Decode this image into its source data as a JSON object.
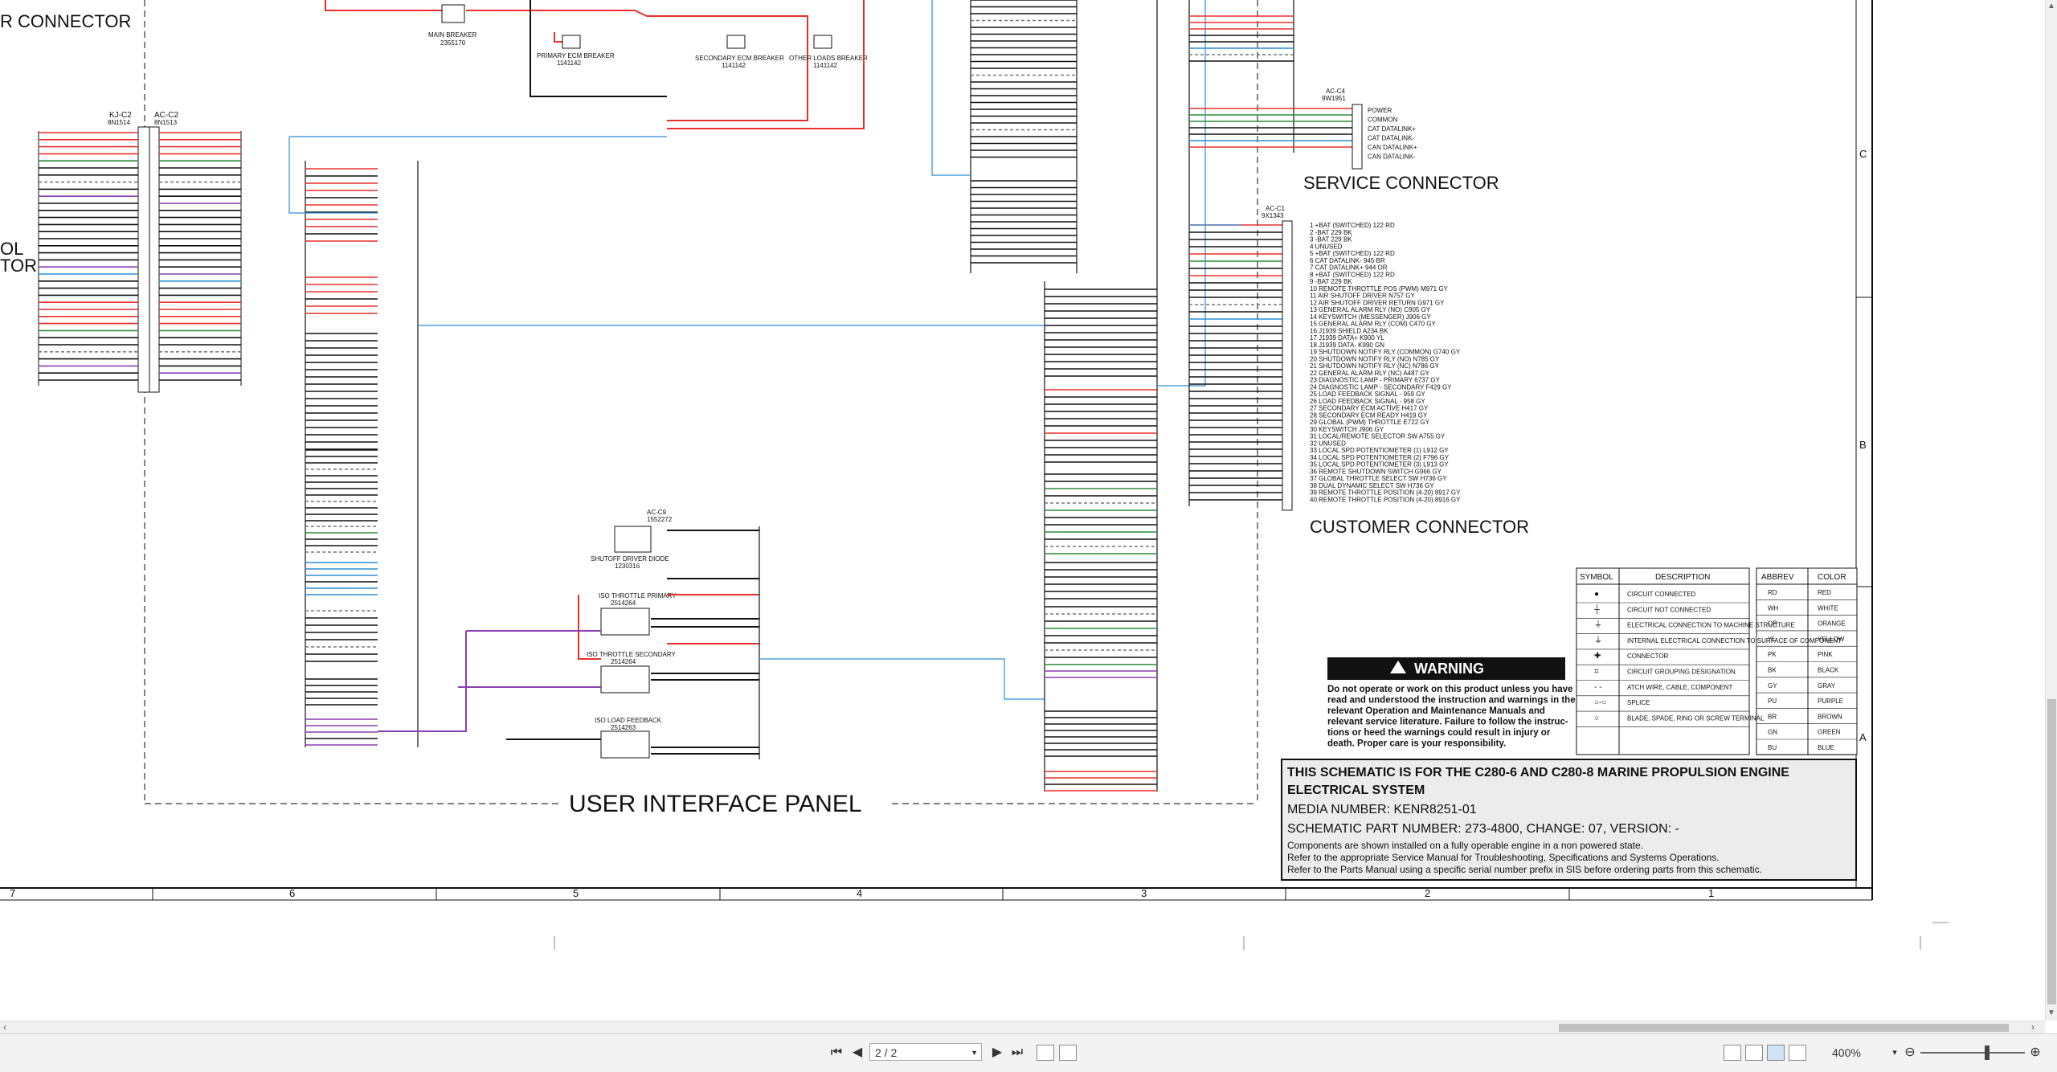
{
  "document": {
    "title_lines": [
      "THIS SCHEMATIC IS FOR THE C280-6 AND C280-8 MARINE PROPULSION ENGINE",
      "ELECTRICAL SYSTEM"
    ],
    "media": "MEDIA NUMBER: KENR8251-01",
    "part": "SCHEMATIC PART NUMBER: 273-4800, CHANGE: 07, VERSION: -",
    "notes": [
      "Components are shown installed on a fully operable engine in a non powered state.",
      "Refer to the appropriate Service Manual for Troubleshooting, Specifications and Systems Operations.",
      "Refer to the Parts Manual using a specific serial number prefix in SIS before ordering parts from this schematic."
    ],
    "section_labels": {
      "user_interface": "USER INTERFACE PANEL",
      "service_connector": "SERVICE CONNECTOR",
      "customer_connector": "CUSTOMER CONNECTOR",
      "connector_top_left": "R CONNECTOR",
      "left_fragment_1": "OL",
      "left_fragment_2": "TOR"
    },
    "warning": {
      "title": "WARNING",
      "lines": [
        "Do not operate or work on this product unless you have",
        "read and understood the instruction and warnings in the",
        "relevant Operation and Maintenance Manuals and",
        "relevant service literature. Failure to follow the instruc-",
        "tions or heed the warnings could result in injury or",
        "death. Proper care is your responsibility."
      ]
    },
    "grid_columns": [
      "7",
      "6",
      "5",
      "4",
      "3",
      "2",
      "1"
    ],
    "grid_rows": [
      "C",
      "B",
      "A"
    ],
    "components": {
      "main_breaker": [
        "MAIN BREAKER",
        "2355170"
      ],
      "primary_ecm": [
        "PRIMARY ECM BREAKER",
        "1141142"
      ],
      "secondary_ecm": [
        "SECONDARY ECM BREAKER",
        "1141142"
      ],
      "other_loads": [
        "OTHER LOADS BREAKER",
        "1141142"
      ],
      "shutoff_diode": [
        "SHUTOFF DRIVER DIODE",
        "1230316"
      ],
      "iso_primary": [
        "ISO THROTTLE PRIMARY",
        "2514264"
      ],
      "iso_secondary": [
        "ISO THROTTLE SECONDARY",
        "2514264"
      ],
      "iso_load": [
        "ISO LOAD FEEDBACK",
        "2514263"
      ],
      "ac_c9": [
        "AC-C9",
        "1552272"
      ],
      "kj_c2": [
        "KJ-C2",
        "8N1514"
      ],
      "ac_c2": [
        "AC-C2",
        "8N1513"
      ],
      "ac_c4": [
        "AC-C4",
        "9W1951"
      ],
      "ac_c1": [
        "AC-C1",
        "9X1343"
      ]
    },
    "service_pins": [
      "POWER",
      "COMMON",
      "CAT DATALINK+",
      "CAT DATALINK-",
      "CAN DATALINK+",
      "CAN DATALINK-"
    ],
    "customer_pins": [
      "1 +BAT (SWITCHED) 122 RD",
      "2 -BAT 229 BK",
      "3 -BAT 229 BK",
      "4 UNUSED",
      "5 +BAT (SWITCHED) 122 RD",
      "6 CAT DATALINK- 945 BR",
      "7 CAT DATALINK+ 944 OR",
      "8 +BAT (SWITCHED) 122 RD",
      "9 -BAT 229 BK",
      "10 REMOTE THROTTLE POS (PWM) M971 GY",
      "11 AIR SHUTOFF DRIVER N757 GY",
      "12 AIR SHUTOFF DRIVER RETURN G971 GY",
      "13 GENERAL ALARM RLY (NO) C905 GY",
      "14 KEYSWITCH (MESSENGER) J906 GY",
      "15 GENERAL ALARM RLY (COM) C470 GY",
      "16 J1939 SHIELD A234 BK",
      "17 J1939 DATA+ K900 YL",
      "18 J1939 DATA- K990 GN",
      "19 SHUTDOWN NOTIFY RLY (COMMON) G740 GY",
      "20 SHUTDOWN NOTIFY RLY (NO) N785 GY",
      "21 SHUTDOWN NOTIFY RLY (NC) N786 GY",
      "22 GENERAL ALARM RLY (NC) A487 GY",
      "23 DIAGNOSTIC LAMP - PRIMARY 6737 GY",
      "24 DIAGNOSTIC LAMP - SECONDARY F429 GY",
      "25 LOAD FEEDBACK SIGNAL - 959 GY",
      "26 LOAD FEEDBACK SIGNAL - 958 GY",
      "27 SECONDARY ECM ACTIVE H417 GY",
      "28 SECONDARY ECM READY H419 GY",
      "29 GLOBAL (PWM) THROTTLE E722 GY",
      "30 KEYSWITCH J906 GY",
      "31 LOCAL/REMOTE SELECTOR SW A755 GY",
      "32 UNUSED",
      "33 LOCAL SPD POTENTIOMETER (1) L912 GY",
      "34 LOCAL SPD POTENTIOMETER (2) F796 GY",
      "35 LOCAL SPD POTENTIOMETER (3) L913 GY",
      "36 REMOTE SHUTDOWN SWITCH G966 GY",
      "37 GLOBAL THROTTLE SELECT SW H736 GY",
      "38 DUAL DYNAMIC SELECT SW H736 GY",
      "39 REMOTE THROTTLE POSITION (4-20) 8917 GY",
      "40 REMOTE THROTTLE POSITION (4-20) 8916 GY"
    ],
    "legend": {
      "headers": [
        "SYMBOL",
        "DESCRIPTION",
        "ABBREV",
        "COLOR"
      ],
      "rows": [
        [
          "CIRCUIT CONNECTED",
          "RD",
          "RED"
        ],
        [
          "CIRCUIT NOT CONNECTED",
          "WH",
          "WHITE"
        ],
        [
          "ELECTRICAL CONNECTION TO MACHINE STRUCTURE",
          "OR",
          "ORANGE"
        ],
        [
          "INTERNAL ELECTRICAL CONNECTION TO SURFACE OF COMPONENT",
          "YL",
          "YELLOW"
        ],
        [
          "CONNECTOR",
          "PK",
          "PINK"
        ],
        [
          "CIRCUIT GROUPING DESIGNATION",
          "BK",
          "BLACK"
        ],
        [
          "ATCH WIRE, CABLE, COMPONENT",
          "GY",
          "GRAY"
        ],
        [
          "SPLICE",
          "PU",
          "PURPLE"
        ],
        [
          "BLADE, SPADE, RING OR SCREW TERMINAL",
          "BR",
          "BROWN"
        ],
        [
          "",
          "GN",
          "GREEN"
        ],
        [
          "",
          "BU",
          "BLUE"
        ]
      ]
    }
  },
  "wire_colors": {
    "red": "#e8312a",
    "black": "#111111",
    "blue": "#2a8fd6",
    "purple": "#8a3fb0",
    "green": "#2e8b3a",
    "gray": "#777777",
    "orange": "#e0892a"
  },
  "toolbar": {
    "page_value": "2 / 2",
    "zoom_value": "400%",
    "first_page_icon": "first-page-icon",
    "prev_page_icon": "prev-page-icon",
    "next_page_icon": "next-page-icon",
    "last_page_icon": "last-page-icon",
    "zoom_out_icon": "zoom-out-icon",
    "zoom_in_icon": "zoom-in-icon"
  }
}
